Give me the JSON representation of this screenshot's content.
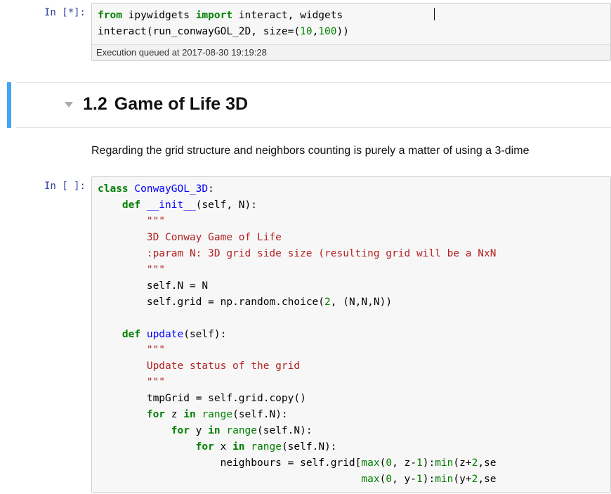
{
  "cell1": {
    "prompt": "In [*]:",
    "code_kw_from": "from",
    "code_module": " ipywidgets ",
    "code_kw_import": "import",
    "code_imports": " interact, widgets",
    "code_line2_a": "interact(run_conwayGOL_2D, size",
    "code_eq": "=",
    "code_lp": "(",
    "code_n1": "10",
    "code_comma": ",",
    "code_n2": "100",
    "code_rp": "))",
    "queued": "Execution queued at 2017-08-30 19:19:28"
  },
  "heading": {
    "number": "1.2",
    "title": "Game of Life 3D"
  },
  "para": "Regarding the grid structure and neighbors counting is purely a matter of using a 3-dime",
  "cell2": {
    "prompt": "In [ ]:",
    "l1_class": "class",
    "l1_name": " ConwayGOL_3D",
    "l1_colon": ":",
    "l2_def": "    def",
    "l2_name": " __init__",
    "l2_sig": "(self, N):",
    "l3_q": "        \"\"\"",
    "l4": "        3D Conway Game of Life",
    "l5": "        :param N: 3D grid side size (resulting grid will be a NxN",
    "l6_q": "        \"\"\"",
    "l7a": "        self.N ",
    "l7eq": "=",
    "l7b": " N",
    "l8a": "        self.grid ",
    "l8eq": "=",
    "l8b": " np.random.choice(",
    "l8n": "2",
    "l8c": ", (N,N,N))",
    "l_blank": "",
    "l9_def": "    def",
    "l9_name": " update",
    "l9_sig": "(self):",
    "l10_q": "        \"\"\"",
    "l11": "        Update status of the grid",
    "l12_q": "        \"\"\"",
    "l13a": "        tmpGrid ",
    "l13eq": "=",
    "l13b": " self.grid.copy()",
    "l14_for": "        for",
    "l14_a": " z ",
    "l14_in": "in",
    "l14_b": " ",
    "l14_range": "range",
    "l14_c": "(self.N):",
    "l15_for": "            for",
    "l15_a": " y ",
    "l15_in": "in",
    "l15_b": " ",
    "l15_range": "range",
    "l15_c": "(self.N):",
    "l16_for": "                for",
    "l16_a": " x ",
    "l16_in": "in",
    "l16_b": " ",
    "l16_range": "range",
    "l16_c": "(self.N):",
    "l17_a": "                    neighbours ",
    "l17_eq": "=",
    "l17_b": " self.grid[",
    "l17_max": "max",
    "l17_c": "(",
    "l17_n0": "0",
    "l17_d": ", z",
    "l17_minus": "-",
    "l17_n1": "1",
    "l17_e": "):",
    "l17_min": "min",
    "l17_f": "(z",
    "l17_plus": "+",
    "l17_n2": "2",
    "l17_g": ",se",
    "l18_a": "                                           ",
    "l18_max": "max",
    "l18_b": "(",
    "l18_n0": "0",
    "l18_c": ", y",
    "l18_minus": "-",
    "l18_n1": "1",
    "l18_d": "):",
    "l18_min": "min",
    "l18_e": "(y",
    "l18_plus": "+",
    "l18_n2": "2",
    "l18_f": ",se"
  }
}
